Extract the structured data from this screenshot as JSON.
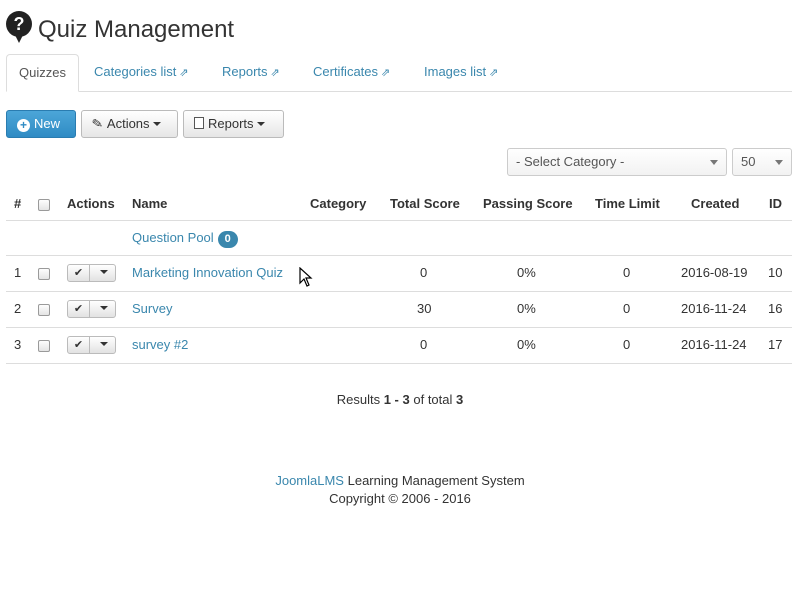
{
  "header": {
    "title": "Quiz Management",
    "icon": "question-bubble-icon"
  },
  "tabs": [
    {
      "label": "Quizzes",
      "active": true
    },
    {
      "label": "Categories list",
      "external": true
    },
    {
      "label": "Reports",
      "external": true
    },
    {
      "label": "Certificates",
      "external": true
    },
    {
      "label": "Images list",
      "external": true
    }
  ],
  "toolbar": {
    "new_label": "New",
    "actions_label": "Actions",
    "reports_label": "Reports"
  },
  "filters": {
    "category_placeholder": "- Select Category -",
    "limit_value": "50"
  },
  "table": {
    "columns": [
      "#",
      "Actions",
      "Name",
      "Category",
      "Total Score",
      "Passing Score",
      "Time Limit",
      "Created",
      "ID"
    ],
    "pool": {
      "label": "Question Pool",
      "count": "0"
    },
    "rows": [
      {
        "num": "1",
        "name": "Marketing Innovation Quiz",
        "category": "",
        "total_score": "0",
        "passing_score": "0%",
        "time_limit": "0",
        "created": "2016-08-19",
        "id": "10"
      },
      {
        "num": "2",
        "name": "Survey",
        "category": "",
        "total_score": "30",
        "passing_score": "0%",
        "time_limit": "0",
        "created": "2016-11-24",
        "id": "16"
      },
      {
        "num": "3",
        "name": "survey #2",
        "category": "",
        "total_score": "0",
        "passing_score": "0%",
        "time_limit": "0",
        "created": "2016-11-24",
        "id": "17"
      }
    ]
  },
  "results": {
    "prefix": "Results",
    "range": "1 - 3",
    "middle": "of total",
    "total": "3"
  },
  "footer": {
    "brand": "JoomlaLMS",
    "tagline": "Learning Management System",
    "copyright": "Copyright © 2006 - 2016"
  },
  "colors": {
    "link": "#3a87ad",
    "primary": "#2f8bc4",
    "border": "#dddddd"
  }
}
